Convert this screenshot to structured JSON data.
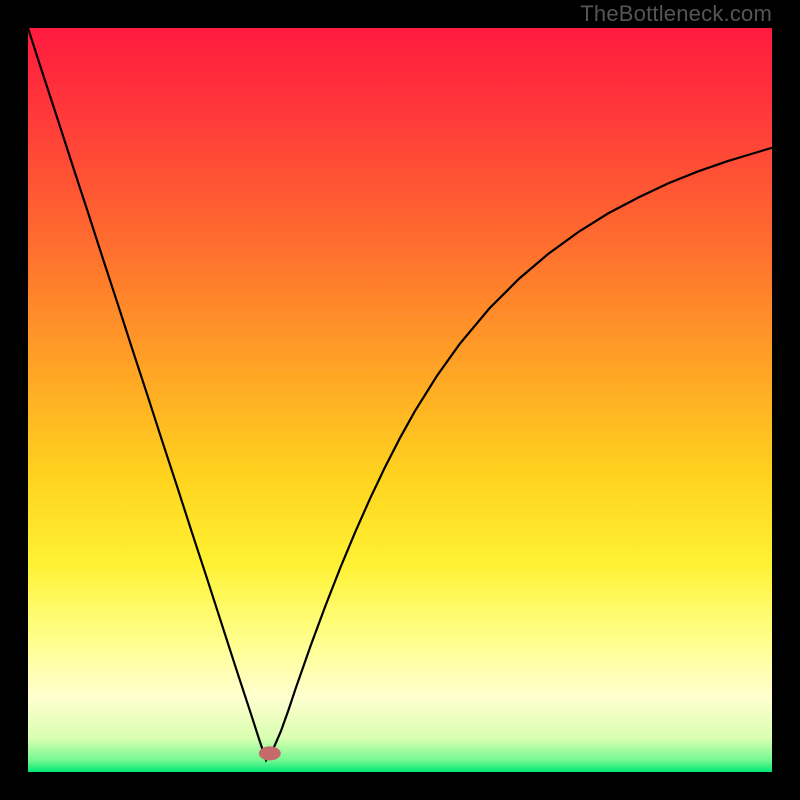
{
  "watermark": "TheBottleneck.com",
  "chart_data": {
    "type": "line",
    "title": "",
    "xlabel": "",
    "ylabel": "",
    "xlim": [
      0,
      100
    ],
    "ylim": [
      0,
      100
    ],
    "background_gradient": {
      "stops": [
        {
          "offset": 0.0,
          "color": "#ff1a3e"
        },
        {
          "offset": 0.12,
          "color": "#ff3a3a"
        },
        {
          "offset": 0.28,
          "color": "#ff6a2f"
        },
        {
          "offset": 0.45,
          "color": "#ffa126"
        },
        {
          "offset": 0.6,
          "color": "#ffd21e"
        },
        {
          "offset": 0.72,
          "color": "#fff233"
        },
        {
          "offset": 0.82,
          "color": "#ffff8a"
        },
        {
          "offset": 0.9,
          "color": "#ffffd0"
        },
        {
          "offset": 0.955,
          "color": "#d8ffb0"
        },
        {
          "offset": 0.985,
          "color": "#70f890"
        },
        {
          "offset": 1.0,
          "color": "#00e676"
        }
      ]
    },
    "marker": {
      "x": 32.5,
      "y": 2.5,
      "color": "#c46a6a"
    },
    "series": [
      {
        "name": "bottleneck-curve",
        "color": "#000000",
        "x": [
          0,
          2,
          4,
          6,
          8,
          10,
          12,
          14,
          16,
          18,
          20,
          22,
          24,
          26,
          28,
          30,
          31,
          32,
          32.5,
          33,
          34,
          35,
          36,
          38,
          40,
          42,
          44,
          46,
          48,
          50,
          52,
          55,
          58,
          62,
          66,
          70,
          74,
          78,
          82,
          86,
          90,
          94,
          98,
          100
        ],
        "y": [
          100,
          93.8,
          87.7,
          81.5,
          75.4,
          69.2,
          63.1,
          56.9,
          50.8,
          44.6,
          38.5,
          32.3,
          26.2,
          20.0,
          13.8,
          7.7,
          4.6,
          1.6,
          2.5,
          3.2,
          5.5,
          8.3,
          11.3,
          17.0,
          22.4,
          27.5,
          32.3,
          36.8,
          41.0,
          44.9,
          48.5,
          53.3,
          57.5,
          62.3,
          66.3,
          69.7,
          72.6,
          75.1,
          77.2,
          79.1,
          80.7,
          82.1,
          83.3,
          83.9
        ]
      }
    ]
  }
}
